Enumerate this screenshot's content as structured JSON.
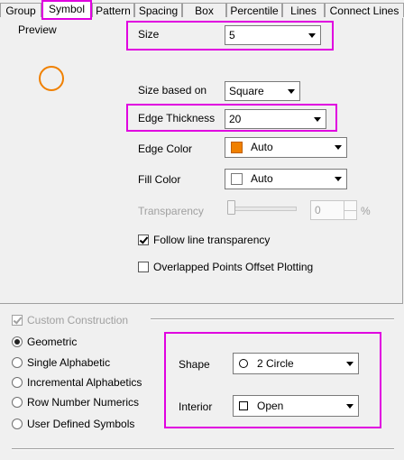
{
  "tabs": [
    {
      "label": "Group"
    },
    {
      "label": "Symbol"
    },
    {
      "label": "Pattern"
    },
    {
      "label": "Spacing"
    },
    {
      "label": "Box"
    },
    {
      "label": "Percentile"
    },
    {
      "label": "Lines"
    },
    {
      "label": "Connect Lines"
    }
  ],
  "preview": {
    "label": "Preview",
    "icon": "orange-circle-icon"
  },
  "size": {
    "label": "Size",
    "value": "5"
  },
  "size_based_on": {
    "label": "Size based on",
    "value": "Square"
  },
  "edge_thickness": {
    "label": "Edge Thickness",
    "value": "20"
  },
  "edge_color": {
    "label": "Edge Color",
    "value": "Auto",
    "swatch": "#f08000"
  },
  "fill_color": {
    "label": "Fill Color",
    "value": "Auto",
    "swatch": "#ffffff"
  },
  "transparency": {
    "label": "Transparency",
    "value": "0",
    "unit": "%",
    "level": 0
  },
  "follow_line_transparency": {
    "label": "Follow line transparency",
    "checked": true
  },
  "overlapped_points": {
    "label": "Overlapped Points Offset Plotting",
    "checked": false
  },
  "custom_construction": {
    "label": "Custom Construction",
    "checked": true
  },
  "construction_options": [
    {
      "label": "Geometric",
      "selected": true
    },
    {
      "label": "Single Alphabetic",
      "selected": false
    },
    {
      "label": "Incremental Alphabetics",
      "selected": false
    },
    {
      "label": "Row Number Numerics",
      "selected": false
    },
    {
      "label": "User Defined Symbols",
      "selected": false
    }
  ],
  "shape": {
    "label": "Shape",
    "value": "2 Circle",
    "icon": "circle-outline-icon"
  },
  "interior": {
    "label": "Interior",
    "value": "Open",
    "icon": "open-square-icon"
  },
  "colors": {
    "highlight": "#e000e0",
    "preview_circle": "#f08000"
  }
}
